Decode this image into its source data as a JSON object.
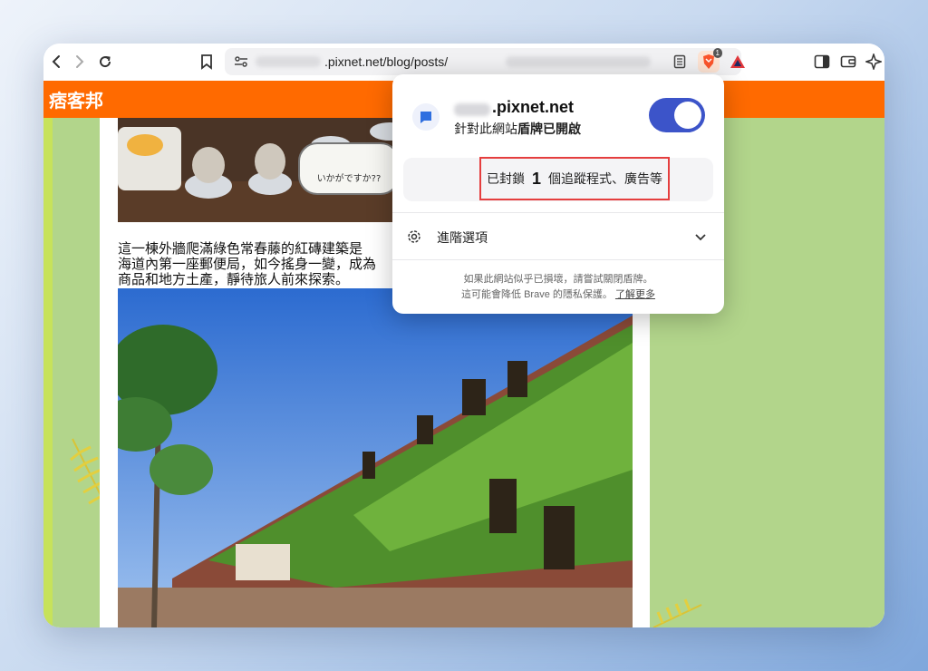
{
  "browser": {
    "url_visible": ".pixnet.net/blog/posts/",
    "brave_badge_count": "1"
  },
  "site": {
    "logo_text": "痞客邦",
    "article_lines": [
      "這一棟外牆爬滿綠色常春藤的紅磚建築是",
      "海道內第一座郵便局，如今搖身一變，成為",
      "商品和地方土產，靜待旅人前來探索。"
    ],
    "photo_sign_text": "いかがですか??"
  },
  "shields_panel": {
    "domain": ".pixnet.net",
    "status_prefix": "針對此網站",
    "status_bold": "盾牌已開啟",
    "blocked_prefix": "已封鎖",
    "blocked_count": "1",
    "blocked_suffix": "個追蹤程式、廣告等",
    "advanced_label": "進階選項",
    "footer_line1": "如果此網站似乎已損壞，請嘗試關閉盾牌。",
    "footer_line2": "這可能會降低 Brave 的隱私保護。",
    "learn_more": "了解更多"
  },
  "colors": {
    "site_header": "#ff6a00",
    "page_bg": "#b2d58b",
    "toggle_on": "#3c54c9",
    "highlight_border": "#e53e3e"
  },
  "icons": [
    "back-icon",
    "forward-icon",
    "reload-icon",
    "bookmark-icon",
    "site-settings-icon",
    "reader-mode-icon",
    "brave-shields-icon",
    "brave-rewards-icon",
    "sidebar-icon",
    "wallet-icon",
    "leo-ai-icon",
    "gear-icon",
    "chevron-down-icon",
    "chat-bubble-icon"
  ]
}
